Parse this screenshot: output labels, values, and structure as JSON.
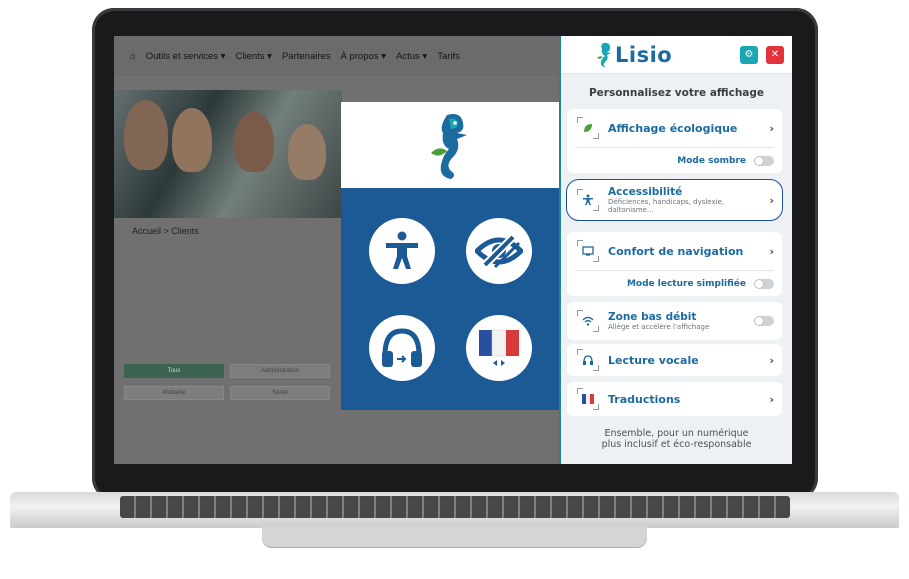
{
  "site": {
    "nav": [
      "Outils et services",
      "Clients",
      "Partenaires",
      "À propos",
      "Actus",
      "Tarifs"
    ],
    "nav_dropdown": [
      true,
      true,
      false,
      true,
      true,
      false
    ],
    "breadcrumb": "Accueil   >   Clients",
    "filters": [
      "Tous",
      "Administration",
      "Mutuelle",
      "Santé"
    ]
  },
  "panel": {
    "brand": "Lisio",
    "title": "Personnalisez votre affichage",
    "items": [
      {
        "label": "Affichage écologique",
        "icon": "leaf-icon",
        "toggle_label": "Mode sombre"
      },
      {
        "label": "Accessibilité",
        "sub": "Déficiences, handicaps, dyslexie, daltonisme...",
        "icon": "accessibility-icon"
      },
      {
        "label": "Confort de navigation",
        "icon": "cursor-screen-icon",
        "toggle_label": "Mode lecture simplifiée"
      },
      {
        "label": "Zone bas débit",
        "sub": "Allège et accélère l'affichage",
        "icon": "wifi-icon"
      },
      {
        "label": "Lecture vocale",
        "icon": "headphones-icon"
      },
      {
        "label": "Traductions",
        "icon": "french-flag-icon"
      }
    ],
    "footer_line1": "Ensemble, pour un numérique",
    "footer_line2": "plus inclusif et éco-responsable"
  },
  "colors": {
    "brand_blue": "#1b6aa0",
    "teal": "#19a7b6",
    "close_red": "#e2323a",
    "card_blue": "#1c5a96"
  }
}
